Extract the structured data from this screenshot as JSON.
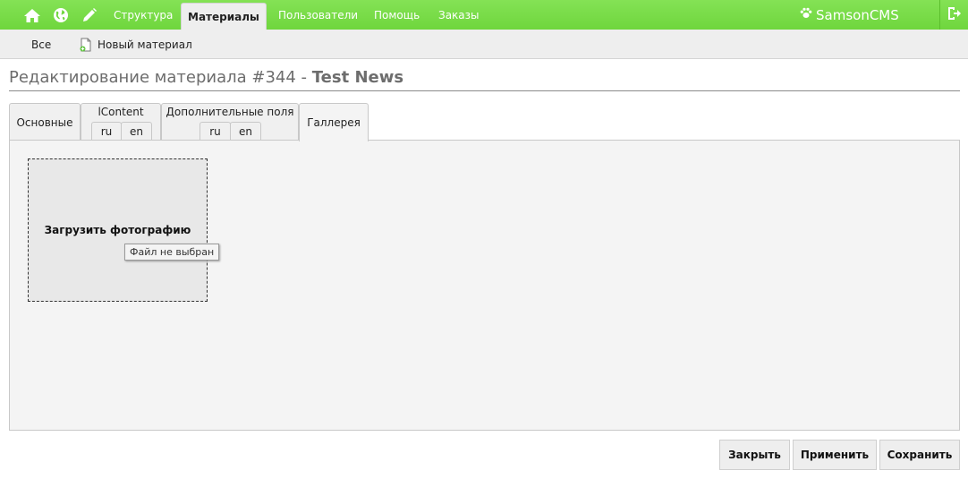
{
  "topbar": {
    "icons": [
      "home-icon",
      "globe-icon",
      "pencil-icon"
    ],
    "nav": [
      "Структура",
      "Материалы",
      "Пользователи",
      "Помощь",
      "Заказы"
    ],
    "active": "Материалы",
    "brand": "SamsonCMS",
    "colors": {
      "bar": "#76d945",
      "text": "#ffffff"
    }
  },
  "subbar": {
    "all_label": "Все",
    "new_label": "Новый материал"
  },
  "heading": {
    "prefix": "Редактирование материала #344 -",
    "title": "Test News"
  },
  "tabs": [
    {
      "label": "Основные"
    },
    {
      "label": "lContent",
      "sub": [
        "ru",
        "en"
      ]
    },
    {
      "label": "Дополнительные поля",
      "sub": [
        "ru",
        "en"
      ]
    },
    {
      "label": "Галлерея",
      "active": true
    }
  ],
  "gallery": {
    "upload_label": "Загрузить фотографию",
    "file_status": "Файл не выбран"
  },
  "buttons": {
    "close": "Закрыть",
    "apply": "Применить",
    "save": "Сохранить"
  }
}
